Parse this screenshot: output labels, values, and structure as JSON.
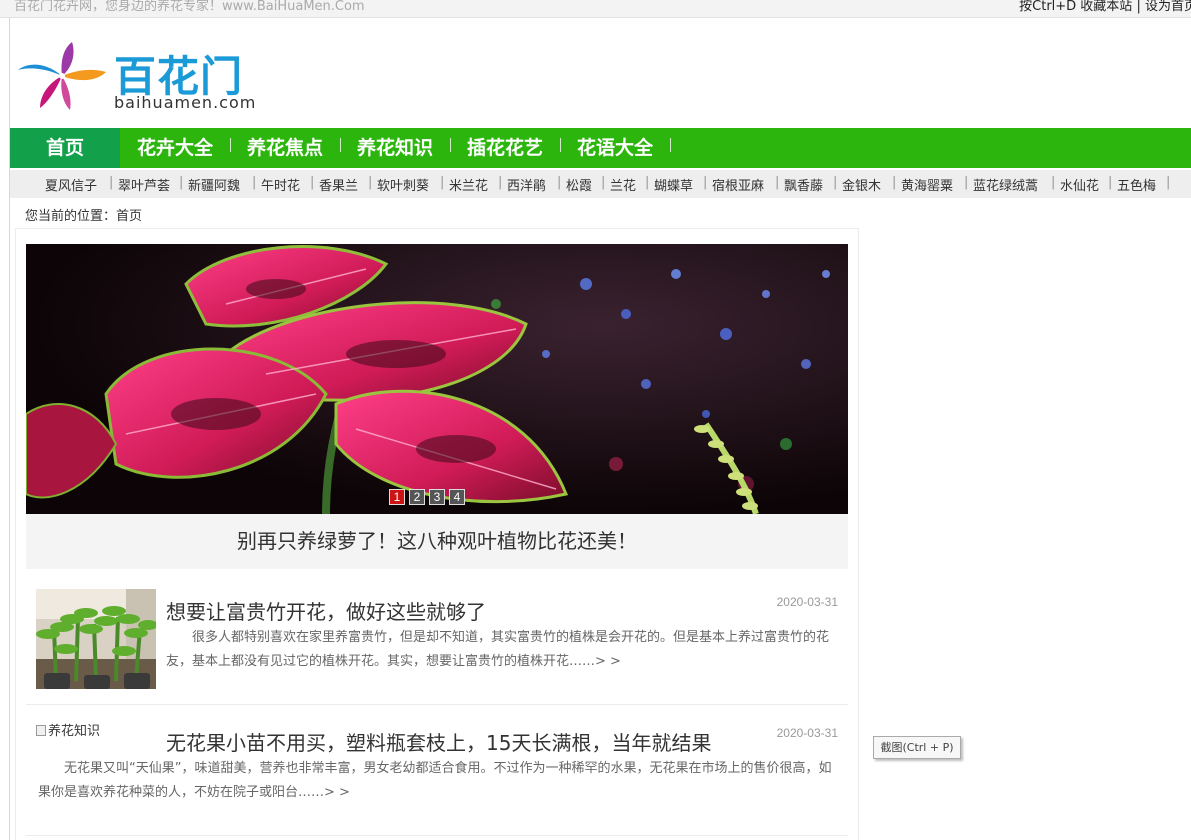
{
  "topbar": {
    "slogan": "百花门花卉网，您身边的养花专家！www.BaiHuaMen.Com",
    "bookmark": "按Ctrl+D 收藏本站",
    "separator": "|",
    "homepage": "设为首页"
  },
  "logo": {
    "brand": "百花门",
    "domain": "baihuamen.com"
  },
  "nav": {
    "items": [
      "首页",
      "花卉大全",
      "养花焦点",
      "养花知识",
      "插花花艺",
      "花语大全"
    ]
  },
  "subnav": {
    "items": [
      "夏风信子",
      "翠叶芦荟",
      "新疆阿魏",
      "午时花",
      "香果兰",
      "软叶刺葵",
      "米兰花",
      "西洋鹃",
      "松霞",
      "兰花",
      "蝴蝶草",
      "宿根亚麻",
      "飘香藤",
      "金银木",
      "黄海罂粟",
      "蓝花绿绒蒿",
      "水仙花",
      "五色梅"
    ],
    "separator": "|"
  },
  "breadcrumb": "您当前的位置：首页",
  "slider": {
    "dots": [
      "1",
      "2",
      "3",
      "4"
    ],
    "active_dot": 0,
    "caption": "别再只养绿萝了！这八种观叶植物比花还美！"
  },
  "articles": [
    {
      "title": "想要让富贵竹开花，做好这些就够了",
      "date": "2020-03-31",
      "summary": "很多人都特别喜欢在家里养富贵竹，但是却不知道，其实富贵竹的植株是会开花的。但是基本上养过富贵竹的花友，基本上都没有见过它的植株开花。其实，想要让富贵竹的植株开花……> >",
      "image_alt": ""
    },
    {
      "title": "无花果小苗不用买，塑料瓶套枝上，15天长满根，当年就结果",
      "date": "2020-03-31",
      "summary": "无花果又叫“天仙果”，味道甜美，营养也非常丰富，男女老幼都适合食用。不过作为一种稀罕的水果，无花果在市场上的售价很高，如果你是喜欢养花种菜的人，不妨在院子或阳台……> >",
      "image_alt": "养花知识"
    }
  ],
  "tooltip": "截图(Ctrl + P)",
  "colors": {
    "nav_green": "#2cb50c",
    "nav_active": "#13a04a",
    "logo_blue": "#1a9ad6",
    "dot_active": "#cc1414"
  }
}
